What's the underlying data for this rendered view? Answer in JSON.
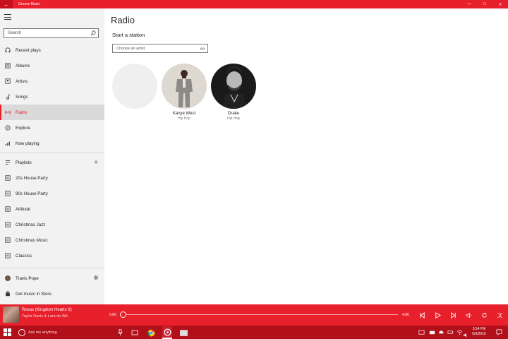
{
  "window": {
    "title": "Groove Music",
    "back_icon": "back-arrow-icon",
    "controls": [
      "minimize-icon",
      "maximize-icon",
      "close-icon"
    ]
  },
  "sidebar": {
    "search_placeholder": "Search",
    "nav": [
      {
        "label": "Recent plays",
        "icon": "headphones-icon"
      },
      {
        "label": "Albums",
        "icon": "album-icon"
      },
      {
        "label": "Artists",
        "icon": "artist-icon"
      },
      {
        "label": "Songs",
        "icon": "music-note-icon"
      },
      {
        "label": "Radio",
        "icon": "radio-icon",
        "active": true
      },
      {
        "label": "Explore",
        "icon": "explore-icon"
      },
      {
        "label": "Now playing",
        "icon": "equalizer-icon"
      }
    ],
    "playlists_label": "Playlists",
    "playlists": [
      "20s House Party",
      "90s House Party",
      "Attitude",
      "Christmas Jazz",
      "Christmas Music",
      "Classics"
    ],
    "user_name": "Travis Pope",
    "store_label": "Get music in Store"
  },
  "main": {
    "title": "Radio",
    "subtitle": "Start a station",
    "artist_placeholder": "Choose an artist",
    "stations": [
      {
        "name": "",
        "genre": ""
      },
      {
        "name": "Kanye West",
        "genre": "Hip Hop"
      },
      {
        "name": "Drake",
        "genre": "Hip Hop"
      }
    ]
  },
  "player": {
    "track_title": "Roxas (Kingdom Hearts II)",
    "track_artist": "Taylor Davis & Lara de Wit",
    "time_current": "0:00",
    "time_total": "4:06",
    "progress": 0.0,
    "controls": [
      "previous-icon",
      "play-icon",
      "next-icon",
      "volume-icon",
      "repeat-icon",
      "shuffle-icon"
    ]
  },
  "taskbar": {
    "cortana_placeholder": "Ask me anything",
    "time": "3:54 PM",
    "date": "5/3/2016"
  },
  "colors": {
    "accent": "#e8202c",
    "taskbar": "#b10f19",
    "sidebar_bg": "#f2f2f2"
  }
}
